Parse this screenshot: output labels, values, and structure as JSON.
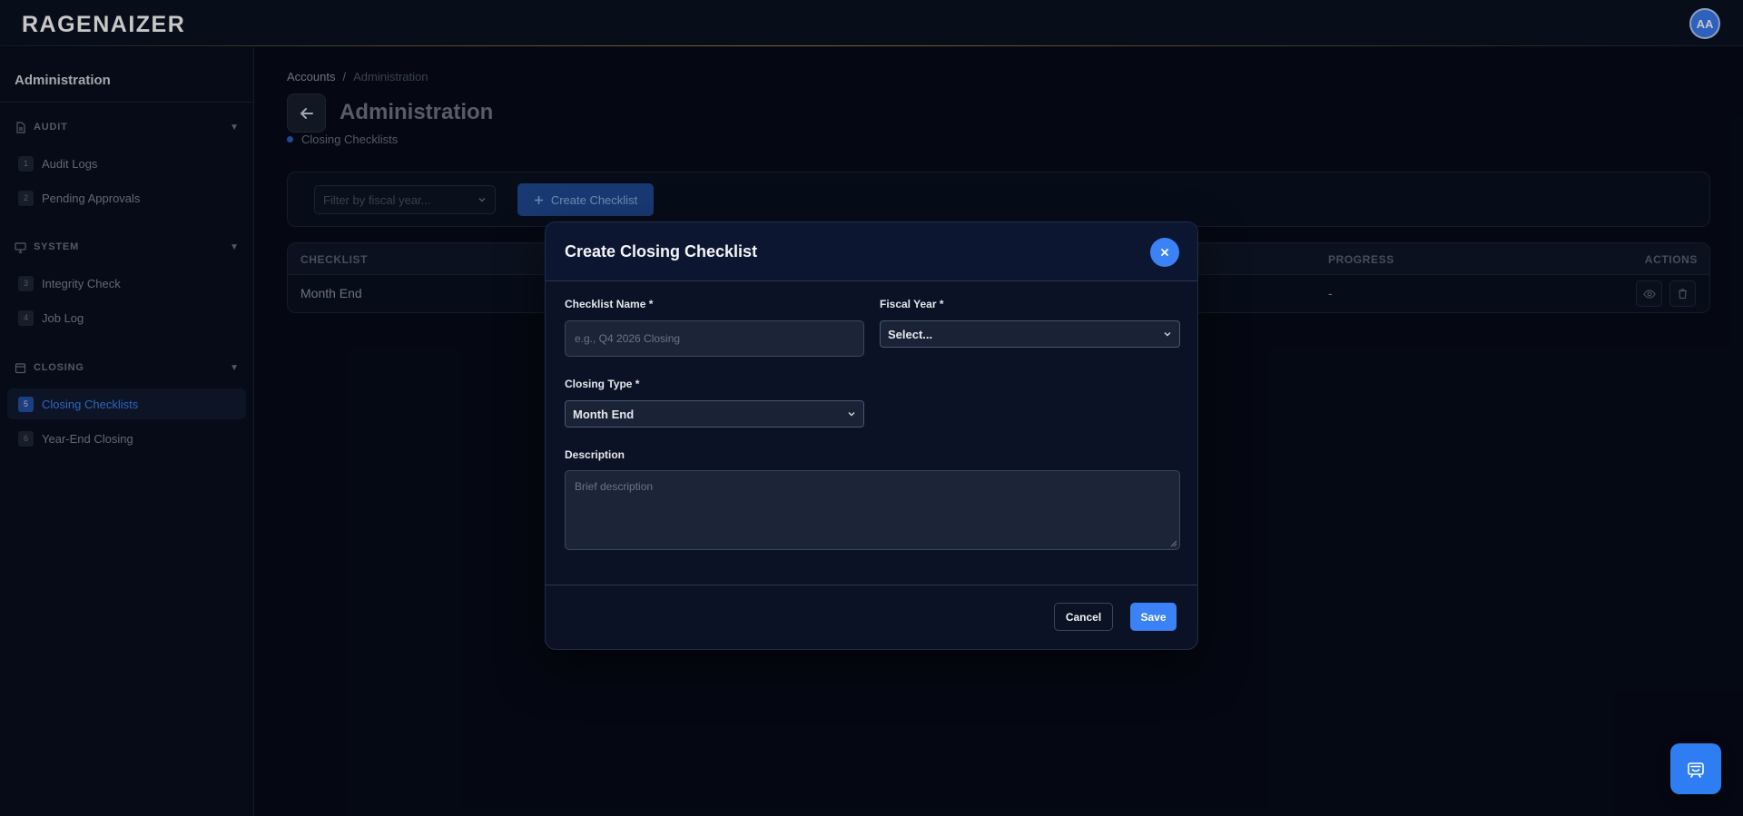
{
  "app": {
    "logo_text": "RAGENAIZER",
    "user_initials": "AA"
  },
  "sidebar": {
    "title": "Administration",
    "sections": [
      {
        "label": "AUDIT",
        "icon": "document-icon",
        "items": [
          {
            "num": "1",
            "label": "Audit Logs"
          },
          {
            "num": "2",
            "label": "Pending Approvals"
          }
        ]
      },
      {
        "label": "SYSTEM",
        "icon": "monitor-icon",
        "items": [
          {
            "num": "3",
            "label": "Integrity Check"
          },
          {
            "num": "4",
            "label": "Job Log"
          }
        ]
      },
      {
        "label": "CLOSING",
        "icon": "calendar-icon",
        "items": [
          {
            "num": "5",
            "label": "Closing Checklists",
            "active": true
          },
          {
            "num": "6",
            "label": "Year-End Closing"
          }
        ]
      }
    ]
  },
  "breadcrumb": {
    "items": [
      "Accounts",
      "Administration"
    ],
    "separator": "/"
  },
  "page": {
    "title": "Administration",
    "subtitle": "Closing Checklists"
  },
  "toolbar": {
    "filter_placeholder": "Filter by fiscal year...",
    "create_label": "Create Checklist"
  },
  "table": {
    "columns": [
      "CHECKLIST",
      "PROGRESS",
      "ACTIONS"
    ],
    "rows": [
      {
        "checklist": "Month End",
        "progress": "-"
      }
    ]
  },
  "modal": {
    "title": "Create Closing Checklist",
    "fields": {
      "name_label": "Checklist Name *",
      "name_placeholder": "e.g., Q4 2026 Closing",
      "fiscal_year_label": "Fiscal Year *",
      "fiscal_year_value": "Select...",
      "closing_type_label": "Closing Type *",
      "closing_type_value": "Month End",
      "description_label": "Description",
      "description_placeholder": "Brief description"
    },
    "cancel_label": "Cancel",
    "save_label": "Save"
  },
  "colors": {
    "accent": "#3b82f6",
    "background": "#070b18",
    "modal_bg": "#0b1226"
  }
}
